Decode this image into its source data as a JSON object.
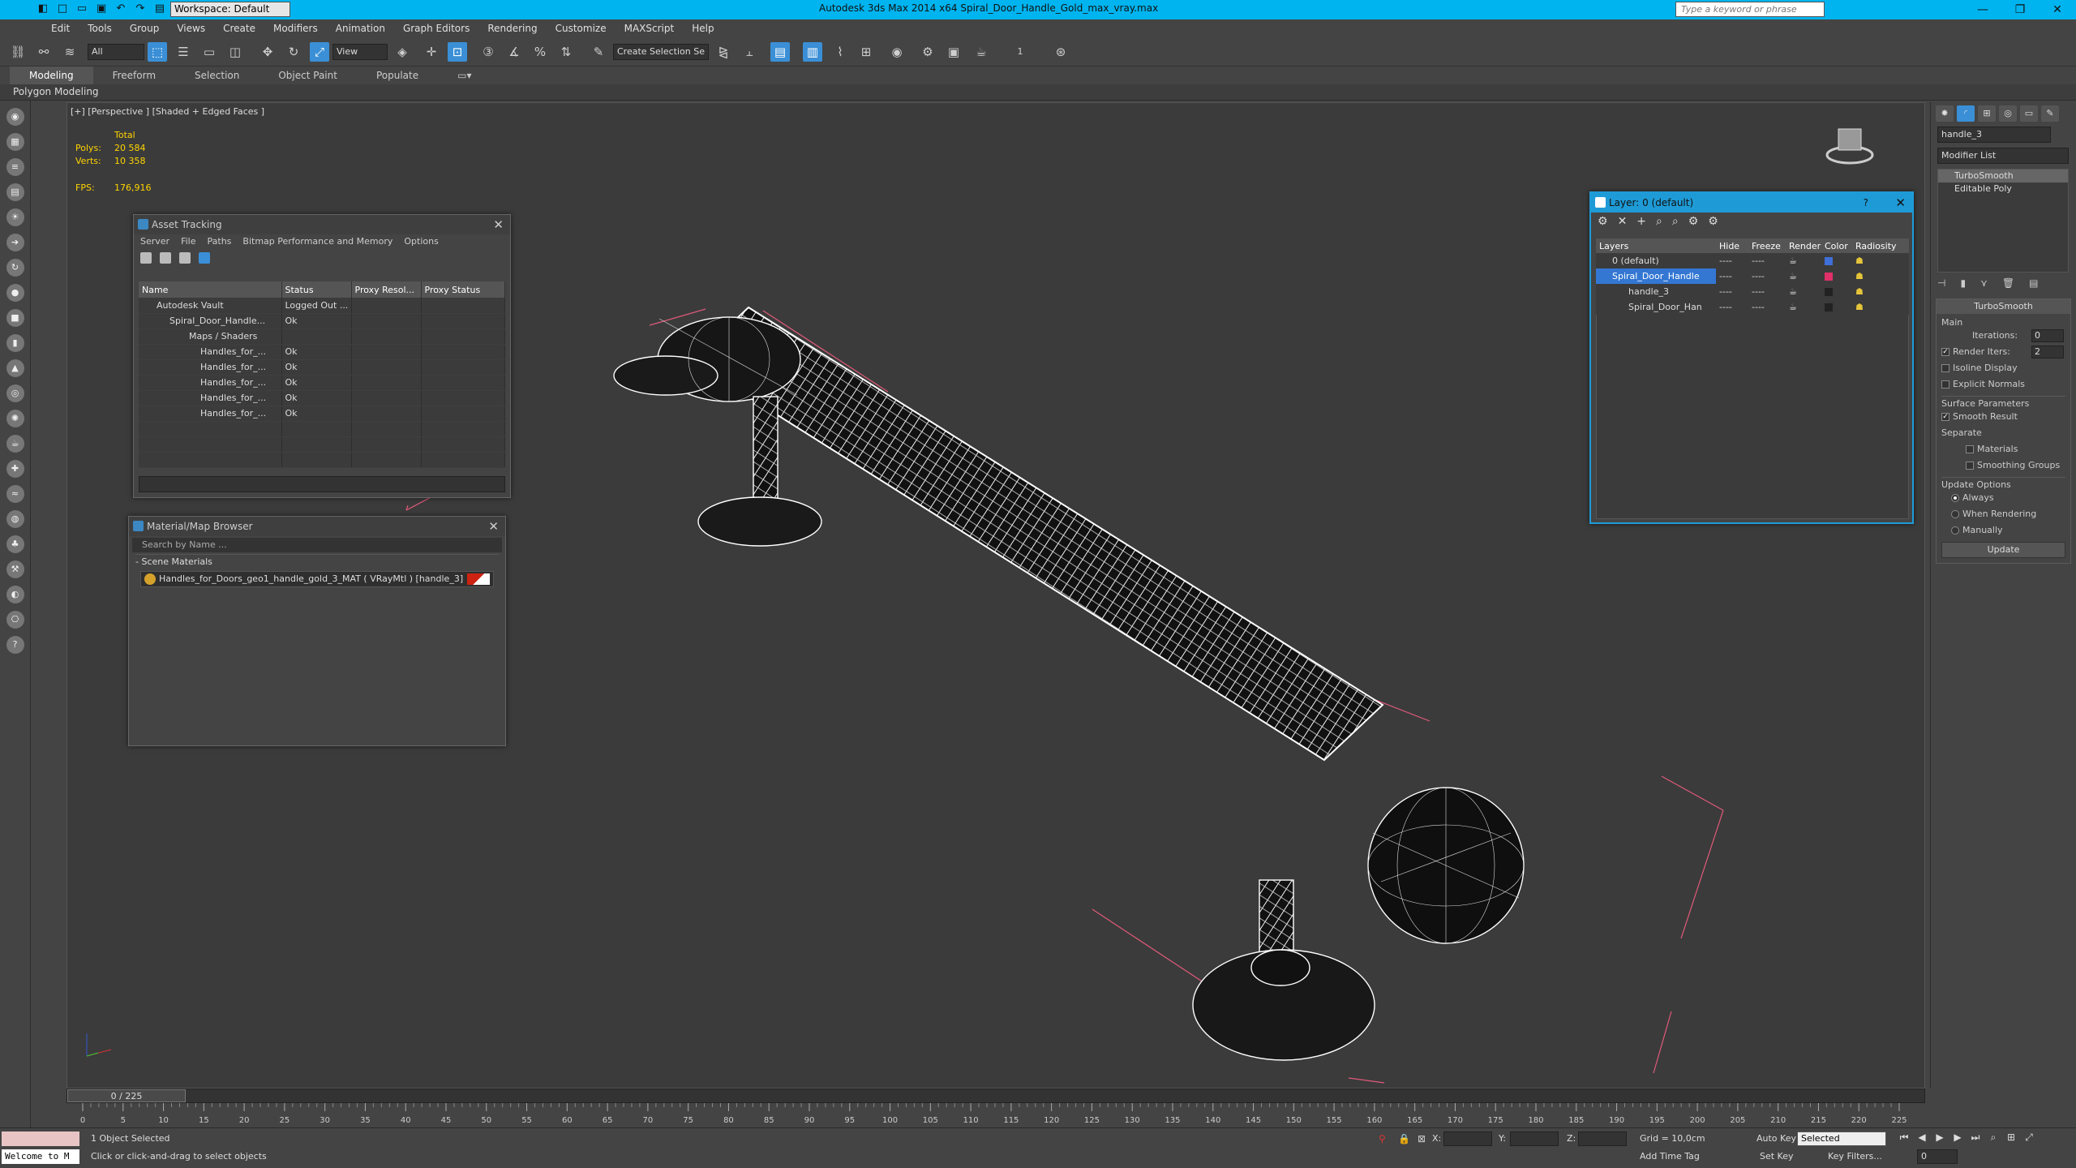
{
  "titlebar": {
    "workspace": "Workspace: Default",
    "app_title": "Autodesk 3ds Max  2014 x64      Spiral_Door_Handle_Gold_max_vray.max",
    "search_placeholder": "Type a keyword or phrase",
    "minimize": "—",
    "restore": "❐",
    "close": "✕"
  },
  "menu": [
    "Edit",
    "Tools",
    "Group",
    "Views",
    "Create",
    "Modifiers",
    "Animation",
    "Graph Editors",
    "Rendering",
    "Customize",
    "MAXScript",
    "Help"
  ],
  "toolbar": {
    "selection_filter": "All",
    "reference_coord": "View",
    "named_selection": "Create Selection Se",
    "snap_count": "1"
  },
  "ribbon": {
    "tabs": [
      "Modeling",
      "Freeform",
      "Selection",
      "Object Paint",
      "Populate"
    ],
    "active_tab": "Modeling",
    "sub_label": "Polygon Modeling"
  },
  "viewport": {
    "label": "[+] [Perspective ] [Shaded + Edged Faces ]",
    "stats_header": "Total",
    "polys_label": "Polys:",
    "polys_value": "20 584",
    "verts_label": "Verts:",
    "verts_value": "10 358",
    "fps_label": "FPS:",
    "fps_value": "176,916"
  },
  "asset_tracking": {
    "title": "Asset Tracking",
    "menu": [
      "Server",
      "File",
      "Paths",
      "Bitmap Performance and Memory",
      "Options"
    ],
    "columns": [
      "Name",
      "Status",
      "Proxy Resol...",
      "Proxy Status"
    ],
    "rows": [
      {
        "name": "Autodesk Vault",
        "status": "Logged Out ..."
      },
      {
        "name": "Spiral_Door_Handle...",
        "status": "Ok"
      },
      {
        "name": "Maps / Shaders",
        "status": ""
      },
      {
        "name": "Handles_for_...",
        "status": "Ok"
      },
      {
        "name": "Handles_for_...",
        "status": "Ok"
      },
      {
        "name": "Handles_for_...",
        "status": "Ok"
      },
      {
        "name": "Handles_for_...",
        "status": "Ok"
      },
      {
        "name": "Handles_for_...",
        "status": "Ok"
      }
    ]
  },
  "material_browser": {
    "title": "Material/Map Browser",
    "search_placeholder": "Search by Name ...",
    "group": "- Scene Materials",
    "material": "Handles_for_Doors_geo1_handle_gold_3_MAT ( VRayMtl ) [handle_3]"
  },
  "layer_manager": {
    "title": "Layer: 0 (default)",
    "help": "?",
    "columns": [
      "Layers",
      "Hide",
      "Freeze",
      "Render",
      "Color",
      "Radiosity"
    ],
    "rows": [
      {
        "name": "0 (default)",
        "color": "#3f6fd8",
        "selected": false
      },
      {
        "name": "Spiral_Door_Handle",
        "color": "#e0306a",
        "selected": true
      },
      {
        "name": "handle_3",
        "color": "#222222",
        "selected": false
      },
      {
        "name": "Spiral_Door_Han",
        "color": "#222222",
        "selected": false
      }
    ],
    "dash": "----"
  },
  "command_panel": {
    "object_name": "handle_3",
    "modifier_list": "Modifier List",
    "stack": [
      "TurboSmooth",
      "Editable Poly"
    ],
    "turbosmooth": {
      "title": "TurboSmooth",
      "main": "Main",
      "iterations_label": "Iterations:",
      "iterations_value": "0",
      "render_iters_label": "Render Iters:",
      "render_iters_value": "2",
      "isoline": "Isoline Display",
      "explicit_normals": "Explicit Normals",
      "surface_params": "Surface Parameters",
      "smooth_result": "Smooth Result",
      "separate": "Separate",
      "materials": "Materials",
      "smoothing_groups": "Smoothing Groups",
      "update_options": "Update Options",
      "always": "Always",
      "when_rendering": "When Rendering",
      "manually": "Manually",
      "update_button": "Update"
    }
  },
  "timeline": {
    "slider": "0 / 225",
    "ticks": [
      "0",
      "5",
      "10",
      "15",
      "20",
      "25",
      "30",
      "35",
      "40",
      "45",
      "50",
      "55",
      "60",
      "65",
      "70",
      "75",
      "80",
      "85",
      "90",
      "95",
      "100",
      "105",
      "110",
      "115",
      "120",
      "125",
      "130",
      "135",
      "140",
      "145",
      "150",
      "155",
      "160",
      "165",
      "170",
      "175",
      "180",
      "185",
      "190",
      "195",
      "200",
      "205",
      "210",
      "215",
      "220",
      "225"
    ]
  },
  "status": {
    "maxscript": "Welcome to M",
    "selection": "1 Object Selected",
    "prompt": "Click or click-and-drag to select objects",
    "x_label": "X:",
    "y_label": "Y:",
    "z_label": "Z:",
    "grid": "Grid = 10,0cm",
    "add_time_tag": "Add Time Tag",
    "auto_key": "Auto Key",
    "set_key": "Set Key",
    "selected": "Selected",
    "key_filters": "Key Filters...",
    "frame": "0"
  }
}
